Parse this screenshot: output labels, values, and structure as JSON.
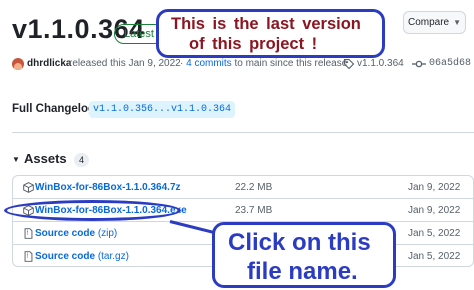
{
  "release": {
    "version": "v1.1.0.364",
    "badge": "Latest",
    "compare_label": "Compare",
    "author": "dhrdlicka",
    "released_text": "released this Jan 9, 2022",
    "commits_prefix": "·",
    "commits_link": "4 commits",
    "commits_suffix": "to main since this release",
    "tag": "v1.1.0.364",
    "commit_hash": "06a5d68"
  },
  "changelog": {
    "label": "Full Changelog:",
    "range": "v1.1.0.356...v1.1.0.364"
  },
  "assets": {
    "title": "Assets",
    "count": "4",
    "items": [
      {
        "name": "WinBox-for-86Box-1.1.0.364.7z",
        "suffix": "",
        "size": "22.2 MB",
        "date": "Jan 9, 2022",
        "icon": "package-icon"
      },
      {
        "name": "WinBox-for-86Box-1.1.0.364.exe",
        "suffix": "",
        "size": "23.7 MB",
        "date": "Jan 9, 2022",
        "icon": "package-icon"
      },
      {
        "name": "Source code",
        "suffix": "(zip)",
        "size": "",
        "date": "Jan 5, 2022",
        "icon": "file-zip-icon"
      },
      {
        "name": "Source code",
        "suffix": "(tar.gz)",
        "size": "",
        "date": "Jan 5, 2022",
        "icon": "file-zip-icon"
      }
    ]
  },
  "annotations": {
    "top_line1": "This is the last version",
    "top_line2": "of this project !",
    "bottom_line1": "Click on this",
    "bottom_line2": "file name."
  },
  "colors": {
    "link": "#0969da",
    "latest_green": "#1a7f37",
    "annotation_blue": "#2b3cc2",
    "annotation_red": "#8b1622"
  }
}
